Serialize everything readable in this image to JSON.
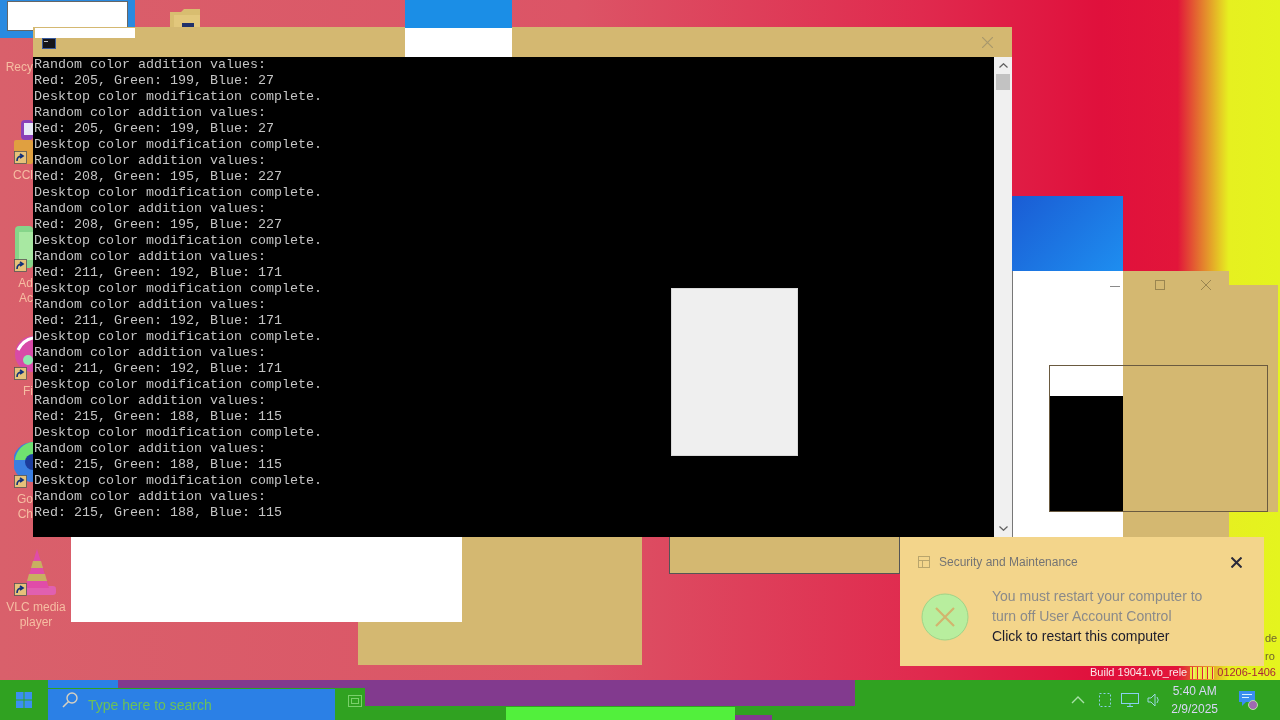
{
  "desktop_icons": [
    {
      "lines": [
        "Recy"
      ]
    },
    {
      "lines": [
        "CCl"
      ]
    },
    {
      "lines": [
        "Ad",
        "Ac"
      ]
    },
    {
      "lines": [
        "Fi"
      ]
    },
    {
      "lines": [
        "Go",
        "Ch"
      ]
    },
    {
      "lines": [
        "VLC media",
        "player"
      ]
    }
  ],
  "console": {
    "lines": [
      "Random color addition values:",
      "Red: 205, Green: 199, Blue: 27",
      "Desktop color modification complete.",
      "Random color addition values:",
      "Red: 205, Green: 199, Blue: 27",
      "Desktop color modification complete.",
      "Random color addition values:",
      "Red: 208, Green: 195, Blue: 227",
      "Desktop color modification complete.",
      "Random color addition values:",
      "Red: 208, Green: 195, Blue: 227",
      "Desktop color modification complete.",
      "Random color addition values:",
      "Red: 211, Green: 192, Blue: 171",
      "Desktop color modification complete.",
      "Random color addition values:",
      "Red: 211, Green: 192, Blue: 171",
      "Desktop color modification complete.",
      "Random color addition values:",
      "Red: 211, Green: 192, Blue: 171",
      "Desktop color modification complete.",
      "Random color addition values:",
      "Red: 215, Green: 188, Blue: 115",
      "Desktop color modification complete.",
      "Random color addition values:",
      "Red: 215, Green: 188, Blue: 115",
      "Desktop color modification complete.",
      "Random color addition values:",
      "Red: 215, Green: 188, Blue: 115"
    ]
  },
  "notification": {
    "title": "Security and Maintenance",
    "message": "You must restart your computer to turn off User Account Control",
    "action": "Click to restart this computer"
  },
  "build_info": [
    "Build 19041.vb_rele",
    "01206-1406"
  ],
  "edge_text": [
    "de",
    "ro"
  ],
  "taskbar": {
    "search": {
      "placeholder": "Type here to search"
    },
    "clock": {
      "time": "5:40 AM",
      "date": "2/9/2025"
    }
  }
}
